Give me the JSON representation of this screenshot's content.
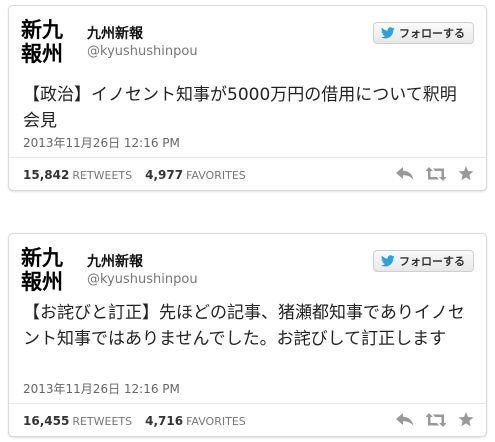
{
  "tweets": [
    {
      "logo_line1": "新九",
      "logo_line2": "報州",
      "name": "九州新報",
      "handle": "@kyushushinpou",
      "follow_label": "フォローする",
      "text": "【政治】イノセント知事が5000万円の借用について釈明会見",
      "timestamp": "2013年11月26日 12:16 PM",
      "retweets": "15,842",
      "retweets_label": "RETWEETS",
      "favorites": "4,977",
      "favorites_label": "FAVORITES"
    },
    {
      "logo_line1": "新九",
      "logo_line2": "報州",
      "name": "九州新報",
      "handle": "@kyushushinpou",
      "follow_label": "フォローする",
      "text": "【お詫びと訂正】先ほどの記事、猪瀬都知事でありイノセント知事ではありませんでした。お詫びして訂正します",
      "timestamp": "2013年11月26日 12:16 PM",
      "retweets": "16,455",
      "retweets_label": "RETWEETS",
      "favorites": "4,716",
      "favorites_label": "FAVORITES"
    }
  ],
  "icons": {
    "bird": "twitter-bird-icon",
    "reply": "reply-icon",
    "retweet": "retweet-icon",
    "favorite": "star-icon"
  },
  "colors": {
    "twitter_blue": "#2ba2dc",
    "icon_gray": "#999999"
  }
}
